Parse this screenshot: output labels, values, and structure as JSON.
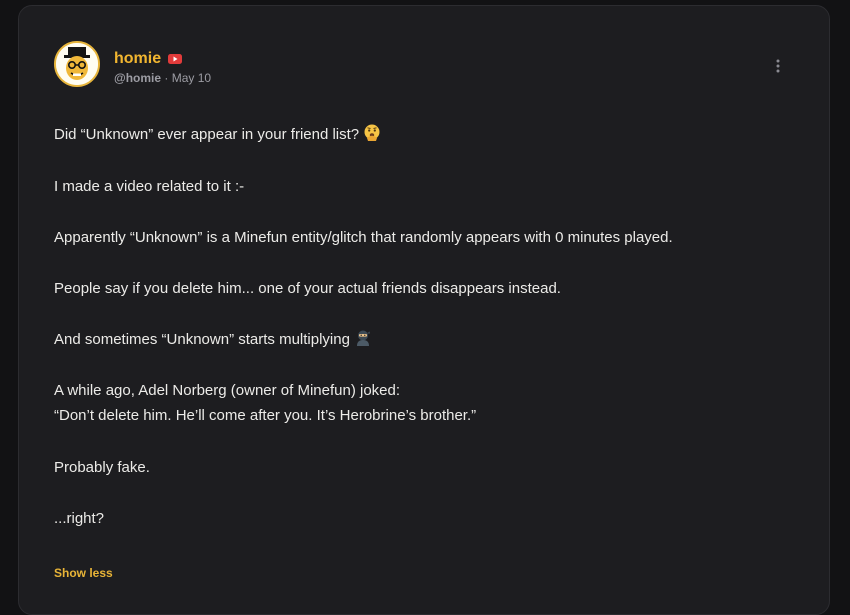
{
  "author": {
    "name": "homie",
    "handle": "@homie",
    "separator": "·",
    "date": "May 10",
    "badge_icon": "youtube-icon",
    "name_color": "#f2b630"
  },
  "menu_icon": "more-vertical-icon",
  "post": {
    "lines": [
      "Did “Unknown” ever appear in your friend list?",
      "I made a video related to it :-",
      "Apparently “Unknown” is a Minefun entity/glitch that randomly appears with 0 minutes played.",
      "People say if you delete him... one of your actual friends disappears instead.",
      "And sometimes “Unknown” starts multiplying",
      "A while ago, Adel Norberg (owner of Minefun) joked:",
      "“Don’t delete him. He’ll come after you. It’s Herobrine’s brother.”",
      "Probably fake.",
      "...right?"
    ],
    "emoji_1": "thinking-face-hand-over-mouth-emoji",
    "emoji_2": "ninja-emoji"
  },
  "show_less_label": "Show less",
  "colors": {
    "background": "#121214",
    "card": "#1d1d20",
    "accent": "#e8b437",
    "text": "#ecebe8",
    "muted": "#9c9ca3"
  }
}
